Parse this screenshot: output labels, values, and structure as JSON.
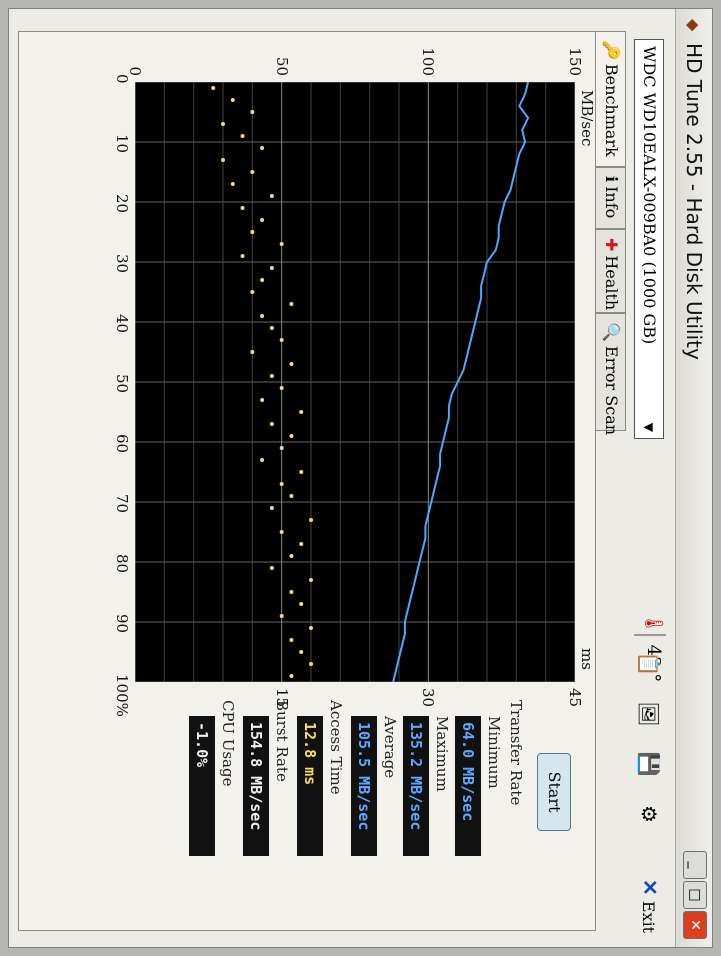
{
  "window": {
    "title": "HD Tune 2.55 - Hard Disk Utility"
  },
  "toolbar": {
    "drive": "WDC   WD10EALX-009BA0 (1000 GB)",
    "temperature": "43",
    "exit_label": "Exit"
  },
  "tabs": [
    {
      "label": "Benchmark",
      "icon": "benchmark-icon"
    },
    {
      "label": "Info",
      "icon": "info-icon"
    },
    {
      "label": "Health",
      "icon": "health-icon"
    },
    {
      "label": "Error Scan",
      "icon": "error-scan-icon"
    }
  ],
  "chart_data": {
    "type": "line",
    "y_left_label": "MB/sec",
    "y_left_ticks": [
      "150",
      "100",
      "50",
      "0"
    ],
    "y_left_range": [
      0,
      150
    ],
    "y_right_label": "ms",
    "y_right_ticks": [
      "45",
      "30",
      "15"
    ],
    "y_right_range": [
      0,
      45
    ],
    "x_ticks": [
      "0",
      "10",
      "20",
      "30",
      "40",
      "50",
      "60",
      "70",
      "80",
      "90",
      "100%"
    ],
    "x_range": [
      0,
      100
    ],
    "grid": true,
    "series": [
      {
        "name": "Transfer Rate",
        "color": "#4fa8ff",
        "x": [
          0,
          2,
          4,
          6,
          8,
          10,
          12,
          14,
          16,
          18,
          20,
          22,
          24,
          26,
          28,
          30,
          32,
          34,
          36,
          38,
          40,
          42,
          44,
          46,
          48,
          50,
          52,
          54,
          56,
          58,
          60,
          62,
          64,
          66,
          68,
          70,
          72,
          74,
          76,
          78,
          80,
          82,
          84,
          86,
          88,
          90,
          92,
          94,
          96,
          98,
          100
        ],
        "y": [
          134,
          133,
          131,
          134,
          132,
          133,
          131,
          130,
          129,
          128,
          126,
          125,
          124,
          124,
          123,
          120,
          119,
          118,
          118,
          117,
          116,
          115,
          114,
          113,
          112,
          110,
          108,
          107,
          107,
          106,
          105,
          104,
          104,
          103,
          102,
          101,
          100,
          99,
          99,
          98,
          97,
          96,
          95,
          94,
          93,
          92,
          92,
          91,
          90,
          89,
          88
        ]
      },
      {
        "name": "Access Time",
        "color": "#f4e060",
        "type": "scatter",
        "x": [
          1,
          3,
          5,
          7,
          9,
          11,
          13,
          15,
          17,
          19,
          21,
          23,
          25,
          27,
          29,
          31,
          33,
          35,
          37,
          39,
          41,
          43,
          45,
          47,
          49,
          51,
          53,
          55,
          57,
          59,
          61,
          63,
          65,
          67,
          69,
          71,
          73,
          75,
          77,
          79,
          81,
          83,
          85,
          87,
          89,
          91,
          93,
          95,
          97,
          99
        ],
        "y": [
          8,
          10,
          12,
          9,
          11,
          13,
          9,
          12,
          10,
          14,
          11,
          13,
          12,
          15,
          11,
          14,
          13,
          12,
          16,
          13,
          14,
          15,
          12,
          16,
          14,
          15,
          13,
          17,
          14,
          16,
          15,
          13,
          17,
          15,
          16,
          14,
          18,
          15,
          17,
          16,
          14,
          18,
          16,
          17,
          15,
          18,
          16,
          17,
          18,
          16
        ]
      }
    ]
  },
  "controls": {
    "start_label": "Start"
  },
  "stats": {
    "transfer_rate_label": "Transfer Rate",
    "minimum_label": "Minimum",
    "minimum_value": "64.0 MB/sec",
    "maximum_label": "Maximum",
    "maximum_value": "135.2 MB/sec",
    "average_label": "Average",
    "average_value": "105.5 MB/sec",
    "access_time_label": "Access Time",
    "access_time_value": "12.8 ms",
    "burst_rate_label": "Burst Rate",
    "burst_rate_value": "154.8 MB/sec",
    "cpu_usage_label": "CPU Usage",
    "cpu_usage_value": "-1.0%"
  }
}
